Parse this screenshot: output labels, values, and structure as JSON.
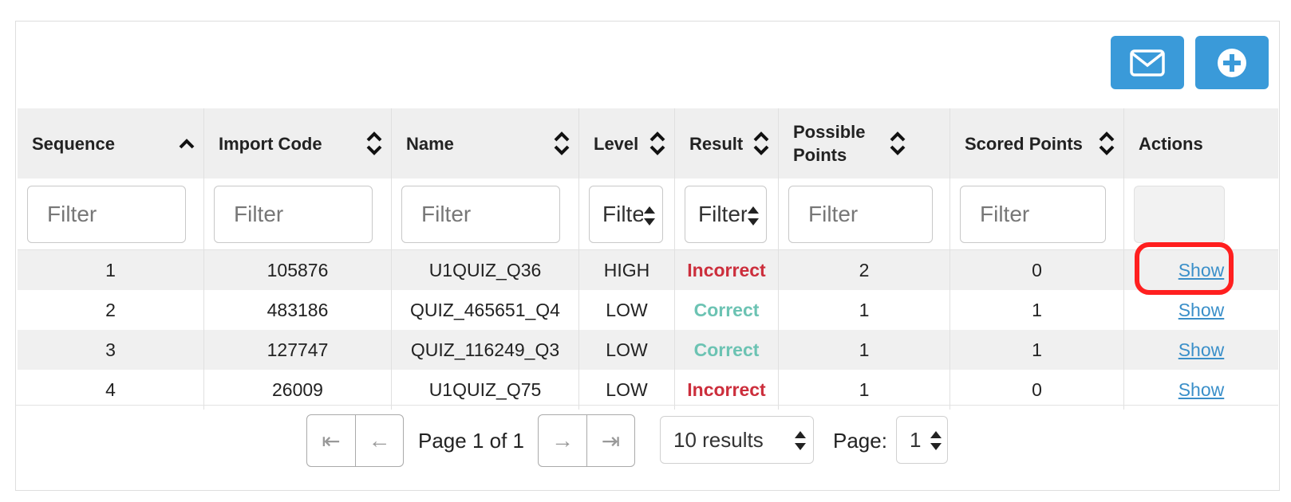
{
  "toolbar": {
    "email_icon": "envelope-icon",
    "add_icon": "plus-circle-icon",
    "accent": "#3a9ad9"
  },
  "table": {
    "columns": [
      {
        "label": "Sequence",
        "sort": "asc"
      },
      {
        "label": "Import Code",
        "sort": "none"
      },
      {
        "label": "Name",
        "sort": "none"
      },
      {
        "label": "Level",
        "sort": "none"
      },
      {
        "label": "Result",
        "sort": "none"
      },
      {
        "label": "Possible Points",
        "sort": "none"
      },
      {
        "label": "Scored Points",
        "sort": "none"
      },
      {
        "label": "Actions",
        "sort": null
      }
    ],
    "filters": {
      "sequence": "Filter",
      "import_code": "Filter",
      "name": "Filter",
      "level": "Filter",
      "result": "Filter",
      "possible_points": "Filter",
      "scored_points": "Filter"
    },
    "rows": [
      {
        "sequence": "1",
        "import_code": "105876",
        "name": "U1QUIZ_Q36",
        "level": "HIGH",
        "result": "Incorrect",
        "possible_points": "2",
        "scored_points": "0",
        "action": "Show"
      },
      {
        "sequence": "2",
        "import_code": "483186",
        "name": "QUIZ_465651_Q4",
        "level": "LOW",
        "result": "Correct",
        "possible_points": "1",
        "scored_points": "1",
        "action": "Show"
      },
      {
        "sequence": "3",
        "import_code": "127747",
        "name": "QUIZ_116249_Q3",
        "level": "LOW",
        "result": "Correct",
        "possible_points": "1",
        "scored_points": "1",
        "action": "Show"
      },
      {
        "sequence": "4",
        "import_code": "26009",
        "name": "U1QUIZ_Q75",
        "level": "LOW",
        "result": "Incorrect",
        "possible_points": "1",
        "scored_points": "0",
        "action": "Show"
      }
    ],
    "result_colors": {
      "Incorrect": "#cc2e3c",
      "Correct": "#6cc3b3"
    }
  },
  "pagination": {
    "first": "⇤",
    "prev": "←",
    "next": "→",
    "last": "⇥",
    "page_info": "Page 1 of 1",
    "page_size": "10 results",
    "page_label": "Page:",
    "page_value": "1"
  }
}
